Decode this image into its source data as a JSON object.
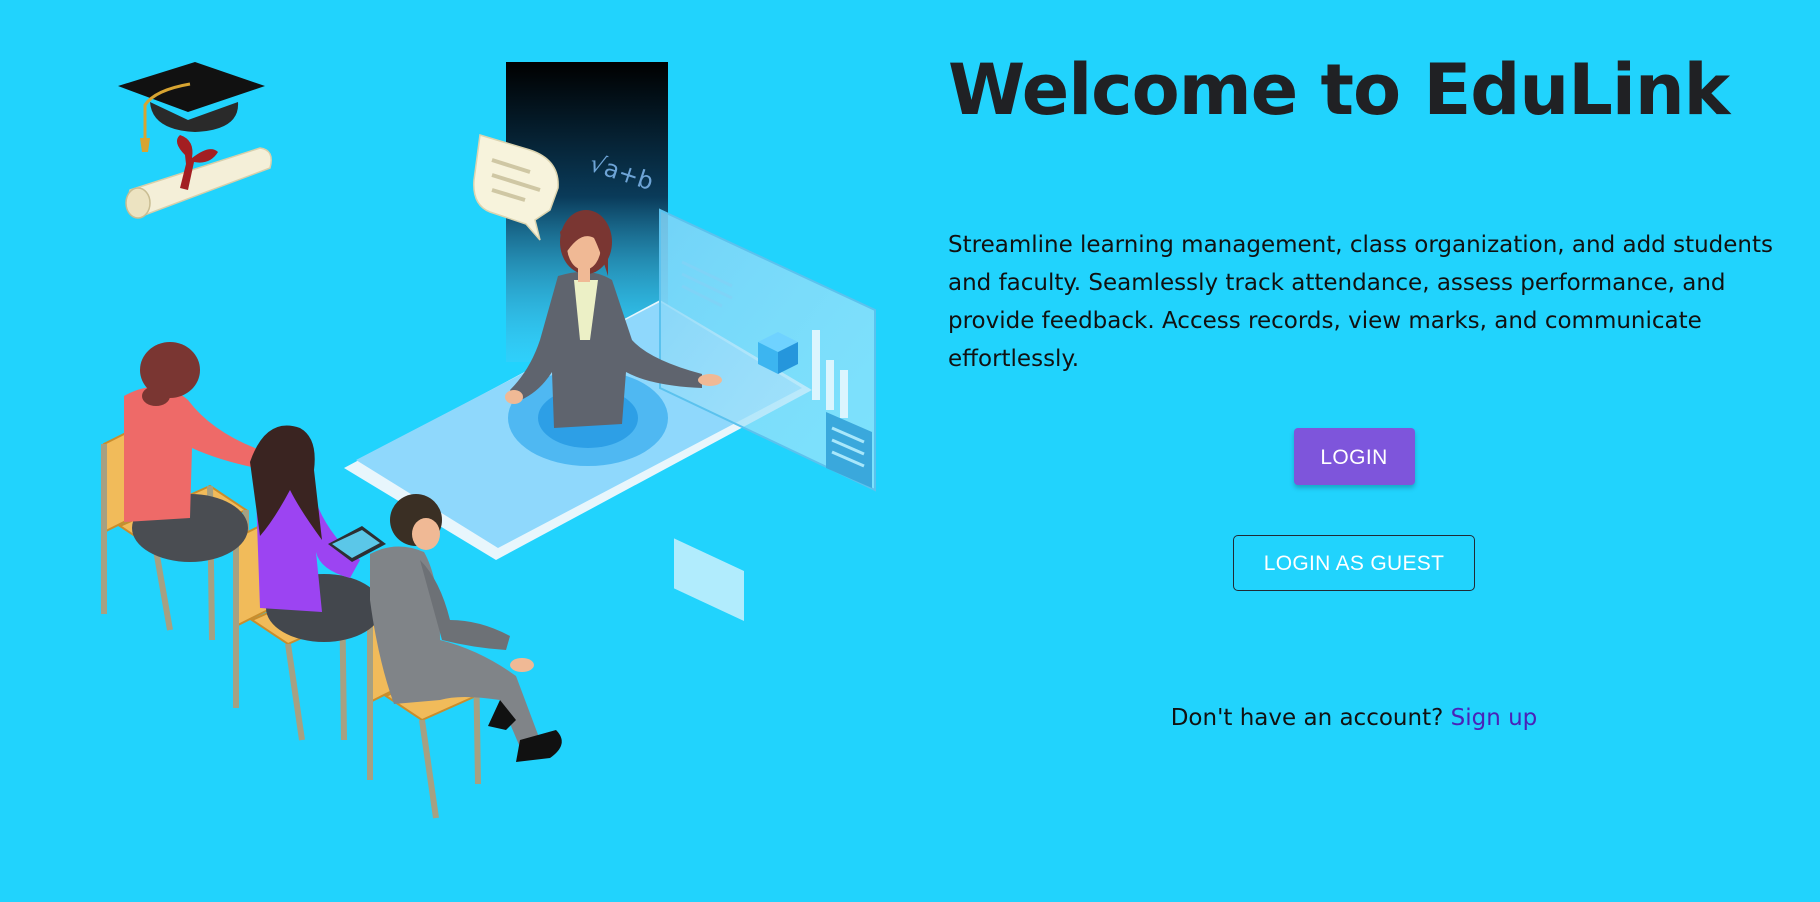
{
  "hero": {
    "title": "Welcome to EduLink",
    "description": "Streamline learning management, class organization, and add students and faculty. Seamlessly track attendance, assess performance, and provide feedback. Access records, view marks, and communicate effortlessly."
  },
  "actions": {
    "login_label": "LOGIN",
    "guest_label": "LOGIN AS GUEST"
  },
  "signup": {
    "prompt": "Don't have an account? ",
    "link_label": "Sign up"
  },
  "illustration": {
    "formula_text": "√a+b",
    "icons": [
      "graduation-cap-icon",
      "diploma-scroll-icon",
      "speech-bubble-icon",
      "cube-icon",
      "bar-chart-icon",
      "tablet-icon"
    ]
  },
  "colors": {
    "background": "#21d3fd",
    "title": "#202124",
    "login_button": "#7e55db",
    "signup_link": "#4a22b8"
  }
}
